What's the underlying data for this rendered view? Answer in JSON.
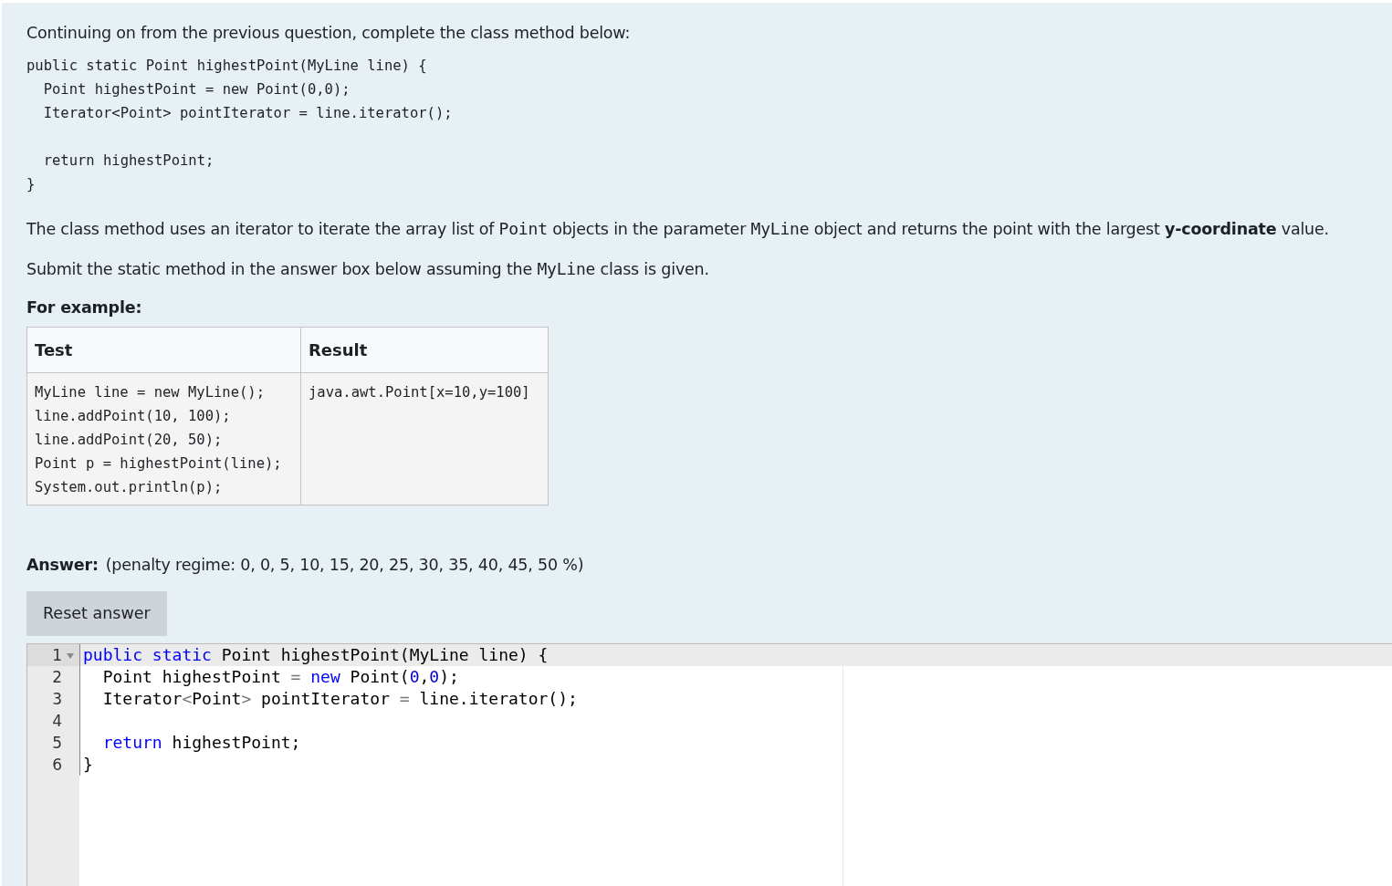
{
  "intro": "Continuing on from the previous question, complete the class method below:",
  "question_code": "public static Point highestPoint(MyLine line) {\n  Point highestPoint = new Point(0,0);\n  Iterator<Point> pointIterator = line.iterator();\n\n  return highestPoint;\n}",
  "paragraphs": [
    [
      {
        "kind": "text",
        "text": "The class method uses an iterator to iterate the array list of "
      },
      {
        "kind": "code",
        "text": "Point"
      },
      {
        "kind": "text",
        "text": " objects in the parameter "
      },
      {
        "kind": "code",
        "text": "MyLine"
      },
      {
        "kind": "text",
        "text": " object and returns the point with the largest "
      },
      {
        "kind": "bold",
        "text": "y-coordinate"
      },
      {
        "kind": "text",
        "text": " value."
      }
    ],
    [
      {
        "kind": "text",
        "text": "Submit the static method in the answer box below assuming the "
      },
      {
        "kind": "code",
        "text": "MyLine"
      },
      {
        "kind": "text",
        "text": " class is given."
      }
    ]
  ],
  "example_heading": "For example:",
  "example_table": {
    "columns": [
      "Test",
      "Result"
    ],
    "rows": [
      [
        "MyLine line = new MyLine();\nline.addPoint(10, 100);\nline.addPoint(20, 50);\nPoint p = highestPoint(line);\nSystem.out.println(p);",
        "java.awt.Point[x=10,y=100]"
      ]
    ]
  },
  "answer": {
    "label": "Answer:",
    "penalty": "(penalty regime: 0, 0, 5, 10, 15, 20, 25, 30, 35, 40, 45, 50 %)",
    "reset_button": "Reset answer"
  },
  "editor": {
    "lines": [
      {
        "number": "1",
        "active": true,
        "foldable": true,
        "tokens": [
          {
            "kind": "keyword",
            "text": "public"
          },
          {
            "kind": "keyword",
            "text": " static"
          },
          {
            "kind": "plain",
            "text": " Point highestPoint(MyLine line) {"
          }
        ]
      },
      {
        "number": "2",
        "active": false,
        "foldable": false,
        "tokens": [
          {
            "kind": "plain",
            "text": "  Point highestPoint "
          },
          {
            "kind": "operator",
            "text": "="
          },
          {
            "kind": "keyword",
            "text": " new"
          },
          {
            "kind": "plain",
            "text": " Point("
          },
          {
            "kind": "number",
            "text": "0"
          },
          {
            "kind": "plain",
            "text": ","
          },
          {
            "kind": "number",
            "text": "0"
          },
          {
            "kind": "plain",
            "text": ");"
          }
        ]
      },
      {
        "number": "3",
        "active": false,
        "foldable": false,
        "tokens": [
          {
            "kind": "plain",
            "text": "  Iterator"
          },
          {
            "kind": "operator",
            "text": "<"
          },
          {
            "kind": "plain",
            "text": "Point"
          },
          {
            "kind": "operator",
            "text": ">"
          },
          {
            "kind": "plain",
            "text": " pointIterator "
          },
          {
            "kind": "operator",
            "text": "="
          },
          {
            "kind": "plain",
            "text": " line.iterator();"
          }
        ]
      },
      {
        "number": "4",
        "active": false,
        "foldable": false
      },
      {
        "number": "5",
        "active": false,
        "foldable": false,
        "tokens": [
          {
            "kind": "keyword",
            "text": "  return"
          },
          {
            "kind": "plain",
            "text": " highestPoint;"
          }
        ]
      },
      {
        "number": "6",
        "active": false,
        "foldable": false,
        "tokens": [
          {
            "kind": "plain",
            "text": "}"
          }
        ]
      }
    ]
  }
}
